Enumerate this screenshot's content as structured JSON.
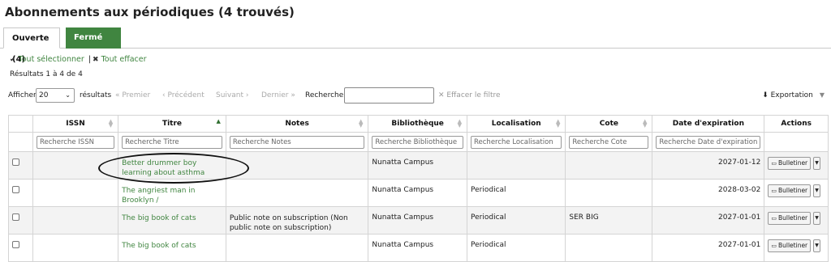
{
  "page_title": "Abonnements aux périodiques (4 trouvés)",
  "tabs": [
    {
      "label": "Ouverte (4)",
      "active": true
    },
    {
      "label": "Fermé (0)",
      "active": false
    }
  ],
  "select_all": "Tout sélectionner",
  "clear_all": "Tout effacer",
  "results_text": "Résultats 1 à 4 de 4",
  "toolbar": {
    "show_label": "Afficher",
    "page_size": "20",
    "results_label": "résultats",
    "first": "Premier",
    "previous": "Précédent",
    "next": "Suivant",
    "last": "Dernier",
    "search_label": "Rechercher :",
    "clear_filter": "Effacer le filtre",
    "export": "Exportation"
  },
  "columns": [
    "",
    "ISSN",
    "Titre",
    "Notes",
    "Bibliothèque",
    "Localisation",
    "Cote",
    "Date d'expiration",
    "Actions"
  ],
  "filters": [
    "Recherche ISSN",
    "Recherche Titre",
    "Recherche Notes",
    "Recherche Bibliothèque",
    "Recherche Localisation",
    "Recherche Cote",
    "Recherche Date d'expiration"
  ],
  "rows": [
    {
      "issn": "",
      "title": "Better drummer boy learning about asthma",
      "notes": "",
      "library": "Nunatta Campus",
      "location": "",
      "callnumber": "",
      "expiration": "2027-01-12",
      "action": "Bulletiner"
    },
    {
      "issn": "",
      "title": "The angriest man in Brooklyn /",
      "notes": "",
      "library": "Nunatta Campus",
      "location": "Periodical",
      "callnumber": "",
      "expiration": "2028-03-02",
      "action": "Bulletiner"
    },
    {
      "issn": "",
      "title": "The big book of cats",
      "notes": "Public note on subscription (Non public note on subscription)",
      "library": "Nunatta Campus",
      "location": "Periodical",
      "callnumber": "SER BIG",
      "expiration": "2027-01-01",
      "action": "Bulletiner"
    },
    {
      "issn": "",
      "title": "The big book of cats",
      "notes": "",
      "library": "Nunatta Campus",
      "location": "Periodical",
      "callnumber": "",
      "expiration": "2027-01-01",
      "action": "Bulletiner"
    }
  ],
  "colors": {
    "accent": "#408540",
    "text": "#222222"
  }
}
